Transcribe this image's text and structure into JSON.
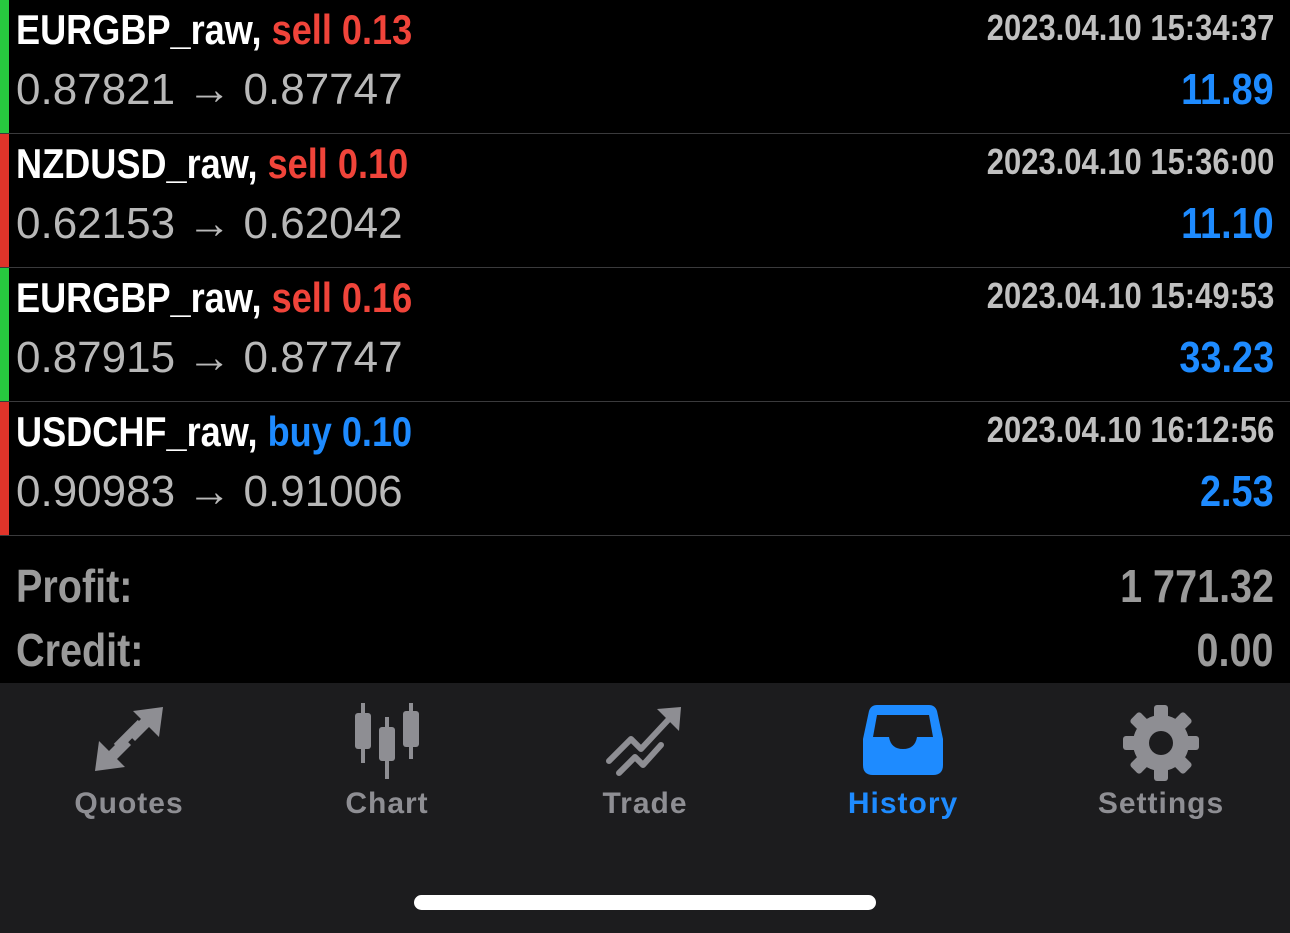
{
  "deals": [
    {
      "symbol": "EURGBP_raw",
      "type": "sell",
      "volume": "0.13",
      "open_price": "0.87821",
      "close_price": "0.87747",
      "time": "2023.04.10 15:34:37",
      "profit": "11.89",
      "stripe_color": "#27c93f",
      "type_color": "#f0443a"
    },
    {
      "symbol": "NZDUSD_raw",
      "type": "sell",
      "volume": "0.10",
      "open_price": "0.62153",
      "close_price": "0.62042",
      "time": "2023.04.10 15:36:00",
      "profit": "11.10",
      "stripe_color": "#e0342a",
      "type_color": "#f0443a"
    },
    {
      "symbol": "EURGBP_raw",
      "type": "sell",
      "volume": "0.16",
      "open_price": "0.87915",
      "close_price": "0.87747",
      "time": "2023.04.10 15:49:53",
      "profit": "33.23",
      "stripe_color": "#27c93f",
      "type_color": "#f0443a"
    },
    {
      "symbol": "USDCHF_raw",
      "type": "buy",
      "volume": "0.10",
      "open_price": "0.90983",
      "close_price": "0.91006",
      "time": "2023.04.10 16:12:56",
      "profit": "2.53",
      "stripe_color": "#e0342a",
      "type_color": "#1e8bff"
    }
  ],
  "arrow": "→",
  "summary": {
    "profit_label": "Profit:",
    "profit_value": "1 771.32",
    "credit_label": "Credit:",
    "credit_value": "0.00"
  },
  "tabs": [
    {
      "label": "Quotes",
      "icon": "quotes-icon",
      "active": false
    },
    {
      "label": "Chart",
      "icon": "chart-icon",
      "active": false
    },
    {
      "label": "Trade",
      "icon": "trade-icon",
      "active": false
    },
    {
      "label": "History",
      "icon": "history-icon",
      "active": true
    },
    {
      "label": "Settings",
      "icon": "gear-icon",
      "active": false
    }
  ],
  "colors": {
    "accent": "#1e8bff",
    "inactive": "#8e8e93",
    "background": "#000000",
    "tabbar": "#1c1c1e"
  }
}
